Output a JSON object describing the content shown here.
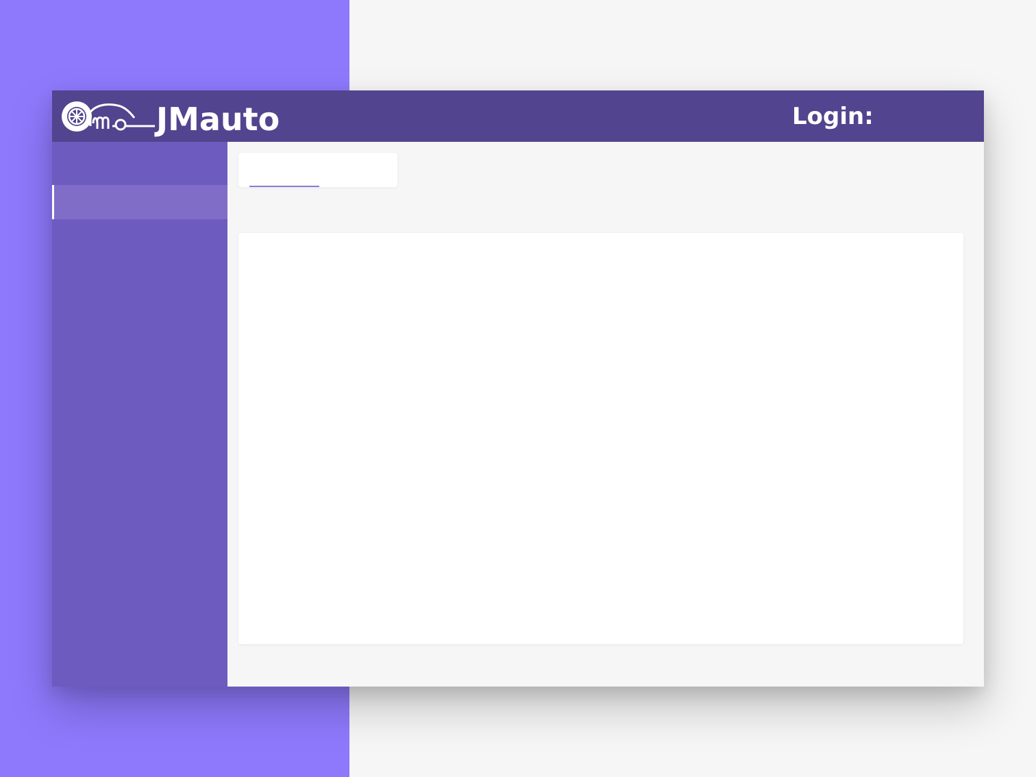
{
  "header": {
    "brand": "JMauto",
    "login_label": "Login:",
    "logo_icon": "car-wheel-logo-icon"
  },
  "sidebar": {
    "items": [
      {
        "label": "",
        "active": false
      },
      {
        "label": "",
        "active": true
      }
    ]
  },
  "tabs": [
    {
      "label": "",
      "active": true
    }
  ],
  "colors": {
    "accent": "#8e79fc",
    "header": "#52448e",
    "sidebar": "#6e5bc0",
    "sidebar_active": "#7f6dc8",
    "tab_indicator": "#8b7bd6"
  }
}
